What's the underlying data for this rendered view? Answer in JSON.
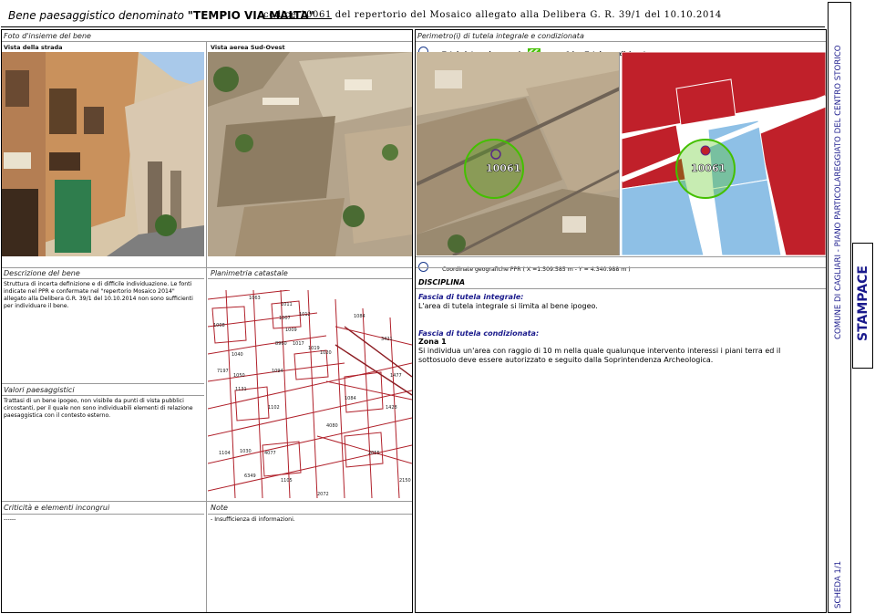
{
  "header": {
    "title_prefix": "Bene paesaggistico denominato ",
    "title_name": "\"TEMPIO VIA MALTA\"",
    "code_label": "codice 10061",
    "code_rest": " del repertorio del Mosaico allegato alla Delibera G. R. 39/1 del 10.10.2014"
  },
  "left_panel": {
    "overview_heading": "Foto d'insieme del bene",
    "street_label": "Vista della strada",
    "aerial_label": "Vista aerea Sud-Ovest",
    "description_heading": "Descrizione del bene",
    "description_text": "Struttura di incerta definizione e di difficile individuazione. Le fonti indicate nel PPR e confermate nel \"repertorio Mosaico 2014\" allegato alla Delibera G.R. 39/1 del 10.10.2014 non sono sufficienti per individuare il bene.",
    "cadastral_heading": "Planimetria catastale",
    "values_heading": "Valori paesaggistici",
    "values_text": "Trattasi di un bene ipogeo, non visibile da punti di vista pubblici circostanti, per il quale non sono individuabili elementi di relazione paesaggistica con il contesto esterno.",
    "critical_heading": "Criticità e elementi incongrui",
    "critical_text": "------",
    "notes_heading": "Note",
    "notes_text": "- Insufficienza di informazioni."
  },
  "right_panel": {
    "perimeter_heading": "Perimetro(i) di tutela integrale e condizionata",
    "legend_integral": "Tutela integrale",
    "legend_zone_open": "(",
    "legend_zone": "zona 1 )",
    "legend_conditional": "Tutela condizionata",
    "map_code_left": "10061",
    "map_code_right": "10061",
    "coordinates": "Coordinate geografiche PPR  ( X =1.509.585 m -  Y = 4.340.988 m )",
    "discipline_heading": "DISCIPLINA",
    "integral_heading": "Fascia di tutela integrale:",
    "integral_text": "L'area di tutela integrale si limita al bene ipogeo.",
    "conditional_heading": "Fascia di tutela condizionata:",
    "zone_label": "Zona 1",
    "conditional_text": "Si individua un'area con raggio di 10 m nella quale qualunque intervento interessi i piani terra ed il sottosuolo deve essere autorizzato e seguito dalla Soprintendenza Archeologica."
  },
  "sidebar": {
    "plan_title": "COMUNE DI CAGLIARI - PIANO PARTICOLAREGGIATO DEL CENTRO STORICO",
    "district": "STAMPACE",
    "sheet": "SCHEDA 1/1"
  },
  "cadastral_numbers": [
    "1063",
    "1011",
    "1007",
    "1012",
    "1009",
    "8960",
    "1017",
    "1019",
    "1020",
    "7197",
    "1040",
    "1050",
    "1131",
    "1102",
    "1104",
    "1030",
    "4077",
    "6349",
    "1105",
    "2072",
    "1008",
    "1094",
    "1084",
    "4080",
    "2055",
    "1084",
    "3421",
    "1477",
    "1428",
    "2150"
  ],
  "colors": {
    "accent_blue": "#1a1a8c",
    "green_zone": "#44c000",
    "red_parcels": "#c0202a",
    "sky_parcels": "#8ec0e6"
  }
}
